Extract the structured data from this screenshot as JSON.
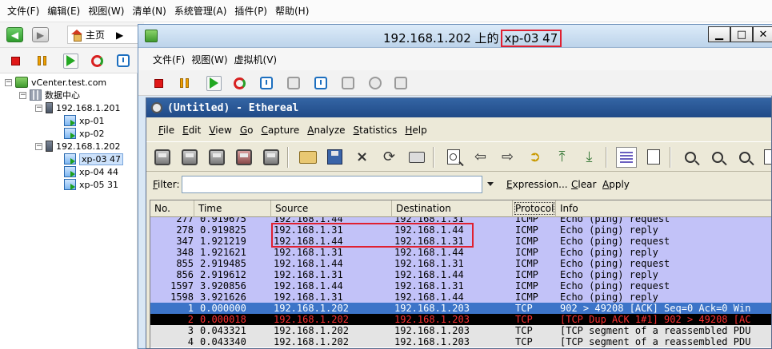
{
  "main_menu": [
    "文件(F)",
    "编辑(E)",
    "视图(W)",
    "清单(N)",
    "系统管理(A)",
    "插件(P)",
    "帮助(H)"
  ],
  "nav": {
    "home_label": "主页"
  },
  "tree": {
    "root": "vCenter.test.com",
    "datacenter": "数据中心",
    "host1": "192.168.1.201",
    "host1_vms": [
      "xp-01",
      "xp-02"
    ],
    "host2": "192.168.1.202",
    "host2_vms": [
      "xp-03 47",
      "xp-04 44",
      "xp-05 31"
    ],
    "selected": "xp-03 47"
  },
  "vm_window": {
    "title_prefix": "192.168.1.202 上的",
    "title_vm": "xp-03 47",
    "menu": [
      "文件(F)",
      "视图(W)",
      "虚拟机(V)"
    ],
    "buttons": {
      "minimize": "▁",
      "maximize": "□",
      "close": "✕"
    }
  },
  "ethereal": {
    "title": "(Untitled) - Ethereal",
    "menu": [
      {
        "u": "F",
        "rest": "ile"
      },
      {
        "u": "E",
        "rest": "dit"
      },
      {
        "u": "V",
        "rest": "iew"
      },
      {
        "u": "G",
        "rest": "o"
      },
      {
        "u": "C",
        "rest": "apture"
      },
      {
        "u": "A",
        "rest": "nalyze"
      },
      {
        "u": "S",
        "rest": "tatistics"
      },
      {
        "u": "H",
        "rest": "elp"
      }
    ],
    "filter": {
      "label_u": "F",
      "label_rest": "ilter:",
      "expression_u": "E",
      "expression_rest": "xpression...",
      "clear_u": "C",
      "clear_rest": "lear",
      "apply_u": "A",
      "apply_rest": "pply",
      "value": ""
    },
    "columns": [
      "No.",
      "Time",
      "Source",
      "Destination",
      "Protocol",
      "Info"
    ],
    "rows": [
      {
        "no": "277",
        "time": "0.919675",
        "src": "192.168.1.44",
        "dst": "192.168.1.31",
        "proto": "ICMP",
        "info": "Echo (ping) request",
        "style": "lav"
      },
      {
        "no": "278",
        "time": "0.919825",
        "src": "192.168.1.31",
        "dst": "192.168.1.44",
        "proto": "ICMP",
        "info": "Echo (ping) reply",
        "style": "lav"
      },
      {
        "no": "347",
        "time": "1.921219",
        "src": "192.168.1.44",
        "dst": "192.168.1.31",
        "proto": "ICMP",
        "info": "Echo (ping) request",
        "style": "lav"
      },
      {
        "no": "348",
        "time": "1.921621",
        "src": "192.168.1.31",
        "dst": "192.168.1.44",
        "proto": "ICMP",
        "info": "Echo (ping) reply",
        "style": "lav"
      },
      {
        "no": "855",
        "time": "2.919485",
        "src": "192.168.1.44",
        "dst": "192.168.1.31",
        "proto": "ICMP",
        "info": "Echo (ping) request",
        "style": "lav"
      },
      {
        "no": "856",
        "time": "2.919612",
        "src": "192.168.1.31",
        "dst": "192.168.1.44",
        "proto": "ICMP",
        "info": "Echo (ping) reply",
        "style": "lav"
      },
      {
        "no": "1597",
        "time": "3.920856",
        "src": "192.168.1.44",
        "dst": "192.168.1.31",
        "proto": "ICMP",
        "info": "Echo (ping) request",
        "style": "lav"
      },
      {
        "no": "1598",
        "time": "3.921626",
        "src": "192.168.1.31",
        "dst": "192.168.1.44",
        "proto": "ICMP",
        "info": "Echo (ping) reply",
        "style": "lav"
      },
      {
        "no": "1",
        "time": "0.000000",
        "src": "192.168.1.202",
        "dst": "192.168.1.203",
        "proto": "TCP",
        "info": "902 > 49208 [ACK] Seq=0 Ack=0 Win",
        "style": "sel"
      },
      {
        "no": "2",
        "time": "0.000018",
        "src": "192.168.1.202",
        "dst": "192.168.1.203",
        "proto": "TCP",
        "info": "[TCP Dup ACK 1#1] 902 > 49208 [AC",
        "style": "err"
      },
      {
        "no": "3",
        "time": "0.043321",
        "src": "192.168.1.202",
        "dst": "192.168.1.203",
        "proto": "TCP",
        "info": "[TCP segment of a reassembled PDU",
        "style": "gray"
      },
      {
        "no": "4",
        "time": "0.043340",
        "src": "192.168.1.202",
        "dst": "192.168.1.203",
        "proto": "TCP",
        "info": "[TCP segment of a reassembled PDU",
        "style": "gray"
      }
    ]
  },
  "colors": {
    "icmp_row_bg": "#c2c2f8",
    "selected_row_bg": "#3c74c8",
    "error_row_bg": "#000000",
    "error_row_fg": "#ff3030",
    "tcp_row_bg": "#e4e4e4",
    "annotation": "#e02030"
  }
}
